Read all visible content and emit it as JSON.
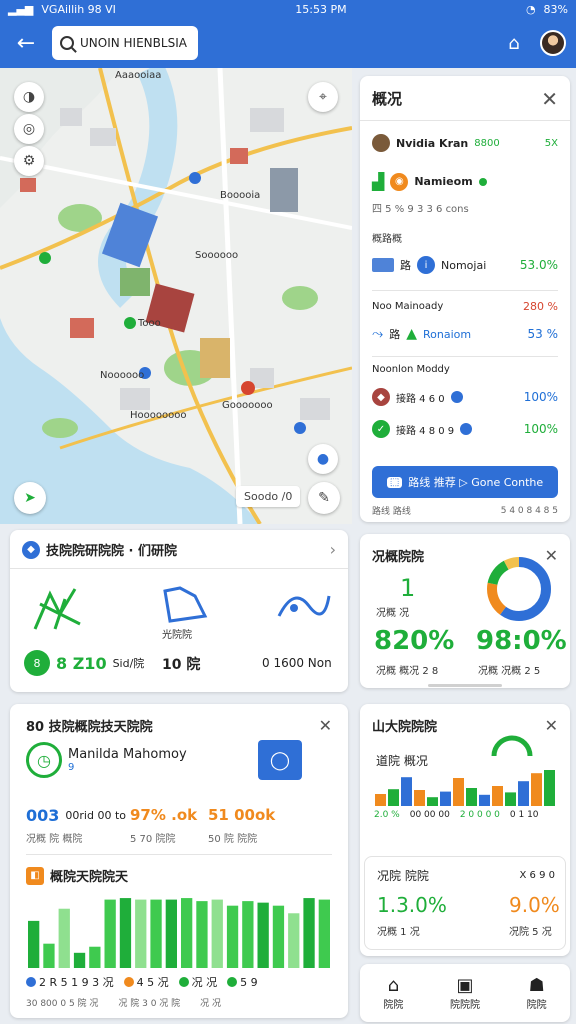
{
  "status": {
    "left": "VGAillih 98 VI",
    "center": "15:53 PM",
    "battery": "83%"
  },
  "topbar": {
    "search_text": "UNOIN HIENBLSIA"
  },
  "map": {
    "scale_label": "Soodo /0"
  },
  "panel": {
    "title": "概况",
    "user_name": "Nvidia Kran",
    "user_value": "8800",
    "user_badge": "5X",
    "location_name": "Namieom",
    "location_sub": "四 5 % 9 3 3 6 cons",
    "section1_label": "概路概",
    "item1_name": "Nomojai",
    "item1_value": "53.0%",
    "section2_label": "Noo Mainoady",
    "section2_value": "280 %",
    "item2_name": "Ronaiom",
    "item2_value": "53 %",
    "section3_label": "Noonlon Moddy",
    "item3_sub": "接路 4 6 0",
    "item3_value": "100%",
    "item4_sub": "接路 4 8 0 9",
    "item4_value": "100%",
    "route_button": "路线 推荐  ▷  Gone Conthe",
    "footer_left": "路线 路线",
    "footer_right": "5 4 0 8 4 8 5"
  },
  "stats": {
    "title": "技院院研院院 · 们研院",
    "metric1_value": "8 Z10",
    "metric1_unit": "Sid/院",
    "metric2_label": "光院院",
    "metric2_value": "10 院",
    "metric3_value": "0 1600 Non"
  },
  "donut": {
    "title": "况概院院",
    "count": "1",
    "count_label": "况概 况",
    "pct1": "820%",
    "pct1_sub": "况概 概况 2 8",
    "pct2": "98:0%",
    "pct2_sub": "况概 况概 2 5"
  },
  "profile": {
    "title": "80 技院概院技天院院",
    "name": "Manilda Mahomoy",
    "name_sub": "9",
    "stat1": "003",
    "stat1_suffix": "00rid 00 to",
    "stat1_label": "况概 院 概院",
    "stat2": "97% .ok",
    "stat2_label": "5 70 院院",
    "stat3": "51 00ok",
    "stat3_label": "50 院 院院",
    "chart_title": "概院天院院天",
    "legend": [
      "2 R 5 1 9 3 况",
      "4 5 况",
      "况 况",
      "5 9"
    ],
    "footer": [
      "30 800 0 5 院 况",
      "况 院 3 0 况 院",
      "况 况"
    ]
  },
  "mini": {
    "title": "山大院院院",
    "subtitle": "道院 概况",
    "bars_labels": [
      "2.0 %",
      "00 00 00",
      "2 0 0 0 0",
      "0 1 10"
    ],
    "sub_title": "况院 院院",
    "sub_badge": "X 6 9 0",
    "pct1": "1.3.0%",
    "pct1_label": "况概 1 况",
    "pct2": "9.0%",
    "pct2_label": "况院 5 况"
  },
  "nav": {
    "items": [
      "院院",
      "院院院",
      "院院"
    ]
  },
  "colors": {
    "primary": "#2f6fd6",
    "green": "#1fae3a",
    "orange": "#f08a1e"
  },
  "chart_data": [
    {
      "type": "bar",
      "values": [
        0.62,
        0.32,
        0.78,
        0.2,
        0.28,
        0.9,
        0.92,
        0.9,
        0.9,
        0.9,
        0.92,
        0.88,
        0.9,
        0.82,
        0.88,
        0.86,
        0.82,
        0.72,
        0.92,
        0.9
      ]
    },
    {
      "type": "pie",
      "values": [
        0.6,
        0.18,
        0.14,
        0.08
      ]
    },
    {
      "type": "bar",
      "values": [
        0.3,
        0.42,
        0.72,
        0.4,
        0.22,
        0.36,
        0.7,
        0.45,
        0.28,
        0.5,
        0.34,
        0.62,
        0.82,
        0.9
      ]
    }
  ]
}
